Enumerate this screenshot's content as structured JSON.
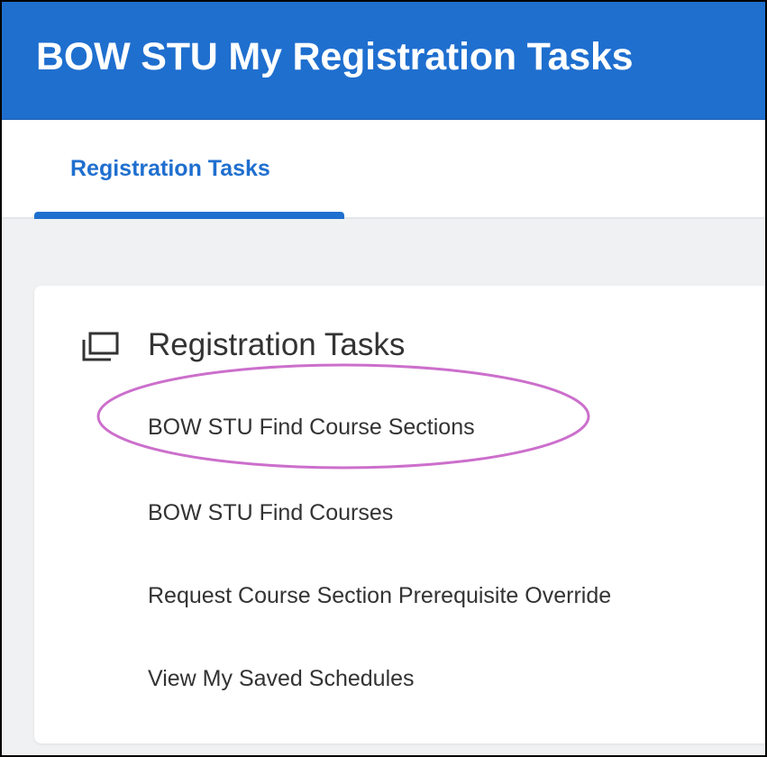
{
  "header": {
    "title": "BOW STU My Registration Tasks"
  },
  "tabs": [
    {
      "label": "Registration Tasks",
      "active": true
    }
  ],
  "card": {
    "icon": "stacked-windows-icon",
    "title": "Registration Tasks",
    "tasks": [
      {
        "label": "BOW STU Find Course Sections"
      },
      {
        "label": "BOW STU Find Courses"
      },
      {
        "label": "Request Course Section Prerequisite Override"
      },
      {
        "label": "View My Saved Schedules"
      }
    ]
  },
  "annotation": {
    "shape": "ellipse",
    "target": "BOW STU Find Course Sections",
    "color": "#cc6fcc"
  },
  "colors": {
    "brand_blue": "#1f6fcf",
    "text_dark": "#333333",
    "page_background": "#f0f1f2"
  }
}
